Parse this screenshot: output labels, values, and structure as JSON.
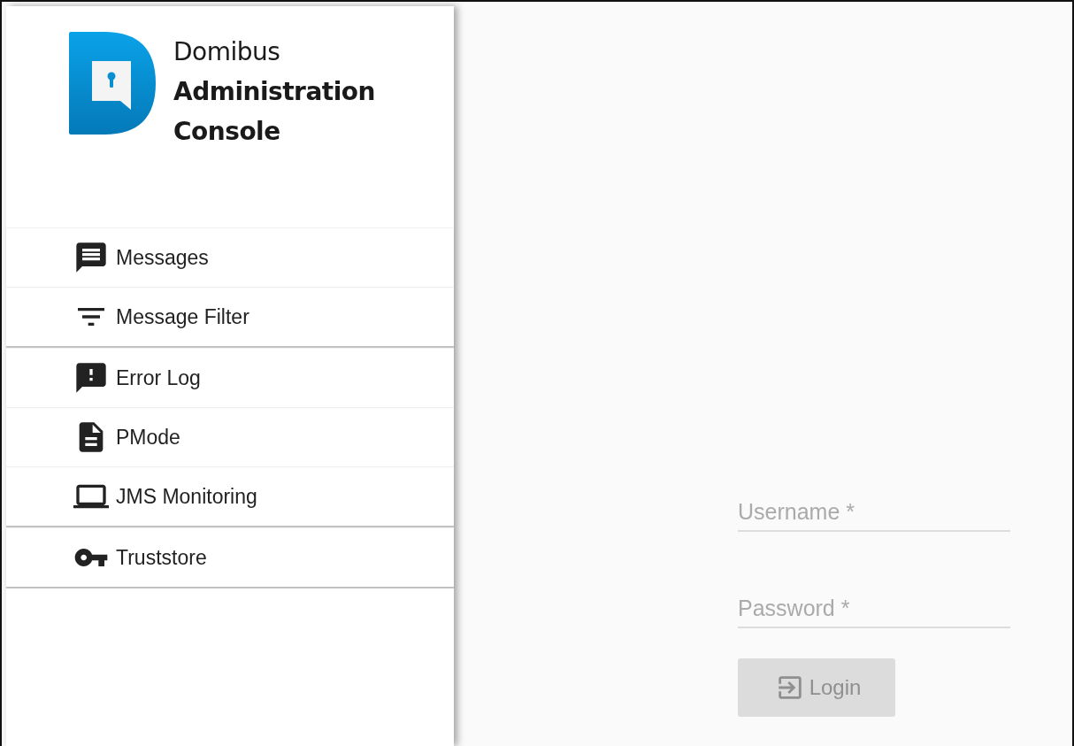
{
  "brand": {
    "lines": [
      "Domibus",
      "Administration",
      "Console"
    ]
  },
  "menu_groups": [
    [
      {
        "label": "Messages"
      },
      {
        "label": "Message Filter"
      }
    ],
    [
      {
        "label": "Error Log"
      },
      {
        "label": "PMode"
      },
      {
        "label": "JMS Monitoring"
      }
    ],
    [
      {
        "label": "Truststore"
      }
    ]
  ],
  "login": {
    "username": {
      "placeholder": "Username *"
    },
    "password": {
      "placeholder": "Password *"
    },
    "button": {
      "label": "Login",
      "disabled": true
    }
  }
}
